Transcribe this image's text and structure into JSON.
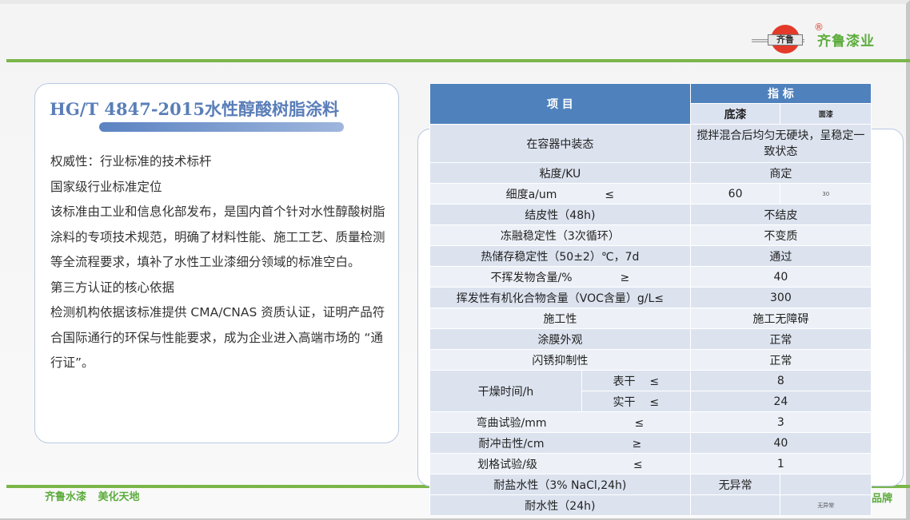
{
  "logo": {
    "mark": "齐鲁",
    "registered": "®",
    "name": "齐鲁漆业"
  },
  "footer": {
    "slogan_a": "齐鲁水漆",
    "slogan_b": "美化天地",
    "right_fragment": "品牌"
  },
  "left_card": {
    "title": "HG/T 4847-2015水性醇酸树脂涂料",
    "paragraphs": [
      "权威性：行业标准的技术标杆",
      "国家级行业标准定位",
      "该标准由工业和信息化部发布，是国内首个针对水性醇酸树脂涂料的专项技术规范，明确了材料性能、施工工艺、质量检测等全流程要求，填补了水性工业漆细分领域的标准空白。",
      "第三方认证的核心依据",
      "检测机构依据该标准提供 CMA/CNAS 资质认证，证明产品符合国际通行的环保与性能要求，成为企业进入高端市场的 “通行证”。"
    ]
  },
  "table": {
    "header_item": "项 目",
    "header_index": "指  标",
    "header_primer": "底漆",
    "header_topcoat": "面漆",
    "rows": {
      "r0": {
        "item": "在容器中装态",
        "value": "搅拌混合后均匀无硬块，呈稳定一致状态"
      },
      "r1": {
        "item": "粘度/KU",
        "value": "商定"
      },
      "r2": {
        "item": "细度a/um",
        "op": "≤",
        "primer": "60",
        "topcoat": "30"
      },
      "r3": {
        "item": "结皮性（48h)",
        "value": "不结皮"
      },
      "r4": {
        "item": "冻融稳定性（3次循环）",
        "value": "不变质"
      },
      "r5": {
        "item": "热储存稳定性（50±2）℃，7d",
        "value": "通过"
      },
      "r6": {
        "item": "不挥发物含量/%",
        "op": "≥",
        "value": "40"
      },
      "r7": {
        "item": "挥发性有机化合物含量（VOC含量）g/L≤",
        "value": "300"
      },
      "r8": {
        "item": "施工性",
        "value": "施工无障碍"
      },
      "r9": {
        "item": "涂膜外观",
        "value": "正常"
      },
      "r10": {
        "item": "闪锈抑制性",
        "value": "正常"
      },
      "r11": {
        "item": "干燥时间/h",
        "sub1": "表干",
        "op1": "≤",
        "value1": "8",
        "sub2": "实干",
        "op2": "≤",
        "value2": "24"
      },
      "r12": {
        "item": "弯曲试验/mm",
        "op": "≤",
        "value": "3"
      },
      "r13": {
        "item": "耐冲击性/cm",
        "op": "≥",
        "value": "40"
      },
      "r14": {
        "item": "划格试验/级",
        "op": "≤",
        "value": "1"
      },
      "r15": {
        "item": "耐盐水性（3% NaCl,24h)",
        "primer": "无异常",
        "topcoat": ""
      },
      "r16": {
        "item": "耐水性（24h)",
        "primer": "",
        "topcoat": "无异常"
      }
    }
  }
}
